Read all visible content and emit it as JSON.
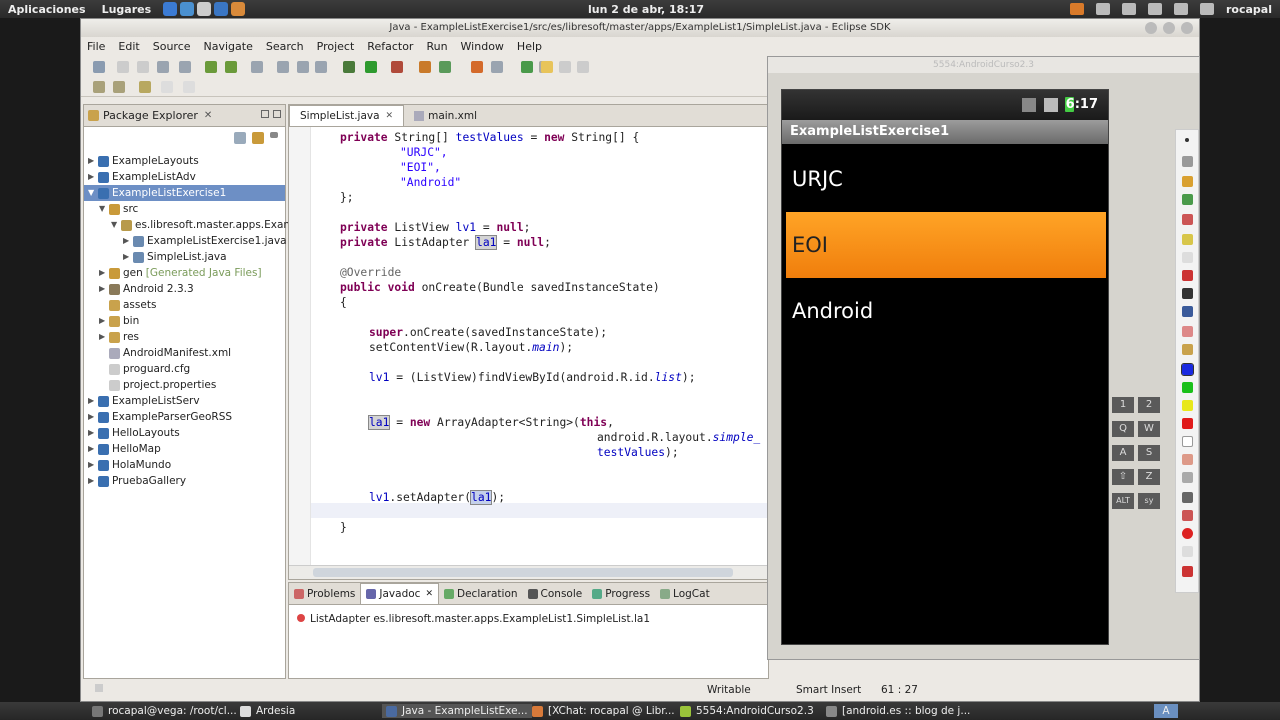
{
  "topbar": {
    "apps_menu": "Aplicaciones",
    "places_menu": "Lugares",
    "clock": "lun  2 de abr, 18:17",
    "user": "rocapal"
  },
  "window": {
    "title": "Java - ExampleListExercise1/src/es/libresoft/master/apps/ExampleList1/SimpleList.java - Eclipse SDK"
  },
  "menu": [
    "File",
    "Edit",
    "Source",
    "Navigate",
    "Search",
    "Project",
    "Refactor",
    "Run",
    "Window",
    "Help"
  ],
  "package_explorer": {
    "title": "Package Explorer",
    "nodes": [
      {
        "label": "ExampleLayouts"
      },
      {
        "label": "ExampleListAdv"
      },
      {
        "label": "ExampleListExercise1"
      },
      {
        "label": "src"
      },
      {
        "label": "es.libresoft.master.apps.Exam"
      },
      {
        "label": "ExampleListExercise1.java"
      },
      {
        "label": "SimpleList.java"
      },
      {
        "label": "gen",
        "note": "[Generated Java Files]"
      },
      {
        "label": "Android 2.3.3"
      },
      {
        "label": "assets"
      },
      {
        "label": "bin"
      },
      {
        "label": "res"
      },
      {
        "label": "AndroidManifest.xml"
      },
      {
        "label": "proguard.cfg"
      },
      {
        "label": "project.properties"
      },
      {
        "label": "ExampleListServ"
      },
      {
        "label": "ExampleParserGeoRSS"
      },
      {
        "label": "HelloLayouts"
      },
      {
        "label": "HelloMap"
      },
      {
        "label": "HolaMundo"
      },
      {
        "label": "PruebaGallery"
      }
    ]
  },
  "editor": {
    "tabs": [
      {
        "label": "SimpleList.java"
      },
      {
        "label": "main.xml"
      }
    ],
    "code": {
      "l1a": "private ",
      "l1b": "String[] ",
      "l1c": "testValues",
      "l1d": " = ",
      "l1e": "new ",
      "l1f": "String[] {",
      "s1": "\"URJC\",",
      "s2": "\"EOI\",",
      "s3": "\"Android\"",
      "l5": "};",
      "l7a": "private ",
      "l7b": "ListView ",
      "l7c": "lv1",
      "l7d": " = ",
      "l7e": "null",
      "l7f": ";",
      "l8a": "private ",
      "l8b": "ListAdapter ",
      "l8c": "la1",
      "l8d": " = ",
      "l8e": "null",
      "l8f": ";",
      "ann": "@Override",
      "l11a": "public ",
      "l11b": "void ",
      "l11c": "onCreate(Bundle savedInstanceState)",
      "brace_open": "{",
      "l14a": "super",
      "l14b": ".onCreate(savedInstanceState);",
      "l15a": "setContentView(R.layout.",
      "l15b": "main",
      "l15c": ");",
      "l17a": "lv1",
      "l17b": " = (ListView)findViewById(android.R.id.",
      "l17c": "list",
      "l17d": ");",
      "l20a": "la1",
      "l20b": " = ",
      "l20c": "new ",
      "l20d": "ArrayAdapter<String>(",
      "l20e": "this",
      "l20f": ",",
      "l21a": "android.R.layout.",
      "l21b": "simple_",
      "l22a": "testValues",
      "l22b": ");",
      "l25a": "lv1",
      "l25b": ".setAdapter(",
      "l25c": "la1",
      "l25d": ");",
      "brace_close": "}"
    }
  },
  "bottom_panel": {
    "tabs": [
      {
        "label": "Problems"
      },
      {
        "label": "Javadoc"
      },
      {
        "label": "Declaration"
      },
      {
        "label": "Console"
      },
      {
        "label": "Progress"
      },
      {
        "label": "LogCat"
      }
    ],
    "javadoc_text": "ListAdapter es.libresoft.master.apps.ExampleList1.SimpleList.la1"
  },
  "statusbar": {
    "writable": "Writable",
    "insert_mode": "Smart Insert",
    "position": "61 : 27"
  },
  "emulator": {
    "title": "5554:AndroidCurso2.3",
    "time": "6:17",
    "app_title": "ExampleListExercise1",
    "items": [
      "URJC",
      "EOI",
      "Android"
    ],
    "selected_index": 1,
    "keys": [
      "1",
      "2",
      "Q",
      "W",
      "A",
      "S",
      "Z",
      "ALT",
      "sy"
    ]
  },
  "taskbar": {
    "items": [
      {
        "label": "rocapal@vega: /root/cl..."
      },
      {
        "label": "Ardesia"
      },
      {
        "label": "Java - ExampleListExe..."
      },
      {
        "label": "[XChat: rocapal @ Libr..."
      },
      {
        "label": "5554:AndroidCurso2.3"
      },
      {
        "label": "[android.es :: blog de j..."
      }
    ]
  },
  "colors": {
    "selection": "#6d8fc5",
    "list_highlight": "#f0850f",
    "keyword": "#7f0055",
    "string": "#2a00ff"
  }
}
